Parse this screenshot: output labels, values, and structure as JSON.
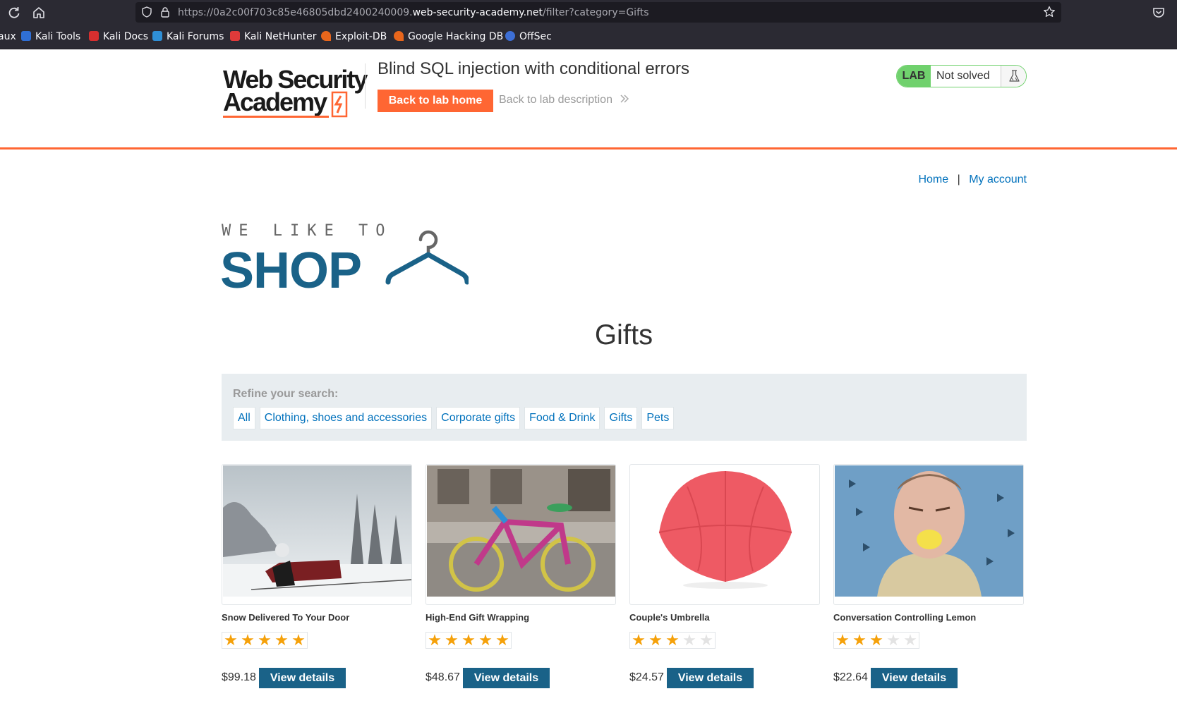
{
  "browser": {
    "url_prefix": "https://0a2c00f703c85e46805dbd2400240009.",
    "url_host": "web-security-academy.net",
    "url_path": "/filter?category=Gifts",
    "bookmarks": [
      {
        "label": "aux",
        "icon": "none",
        "color": "#2b2a33"
      },
      {
        "label": "Kali Tools",
        "icon": "kali-tools-icon",
        "color": "#2f6fd6"
      },
      {
        "label": "Kali Docs",
        "icon": "kali-docs-icon",
        "color": "#d62f2f"
      },
      {
        "label": "Kali Forums",
        "icon": "kali-forums-icon",
        "color": "#2f8fd6"
      },
      {
        "label": "Kali NetHunter",
        "icon": "kali-nethunter-icon",
        "color": "#e03a3a"
      },
      {
        "label": "Exploit-DB",
        "icon": "exploit-db-icon",
        "color": "#e8661c"
      },
      {
        "label": "Google Hacking DB",
        "icon": "ghdb-icon",
        "color": "#e8661c"
      },
      {
        "label": "OffSec",
        "icon": "offsec-icon",
        "color": "#3d6fd6"
      }
    ]
  },
  "lab": {
    "logo_line1": "Web Security",
    "logo_line2": "Academy",
    "title": "Blind SQL injection with conditional errors",
    "back_home": "Back to lab home",
    "back_description": "Back to lab description",
    "badge": "LAB",
    "status": "Not solved",
    "accent": "#ff6633"
  },
  "nav": {
    "home": "Home",
    "separator": "|",
    "account": "My account"
  },
  "shop_logo": {
    "line1": "WE LIKE TO",
    "line2": "SHOP"
  },
  "category": "Gifts",
  "filters": {
    "label": "Refine your search:",
    "items": [
      "All",
      "Clothing, shoes and accessories",
      "Corporate gifts",
      "Food & Drink",
      "Gifts",
      "Pets"
    ]
  },
  "products": [
    {
      "name": "Snow Delivered To Your Door",
      "rating": 5,
      "price": "$99.18",
      "button": "View details"
    },
    {
      "name": "High-End Gift Wrapping",
      "rating": 5,
      "price": "$48.67",
      "button": "View details"
    },
    {
      "name": "Couple's Umbrella",
      "rating": 3,
      "price": "$24.57",
      "button": "View details"
    },
    {
      "name": "Conversation Controlling Lemon",
      "rating": 3,
      "price": "$22.64",
      "button": "View details"
    }
  ],
  "colors": {
    "link": "#0071bc",
    "primary_button": "#1a6288",
    "star_on": "#f5a10a",
    "star_off": "#e3e3e3",
    "lab_green": "#70d16d"
  }
}
